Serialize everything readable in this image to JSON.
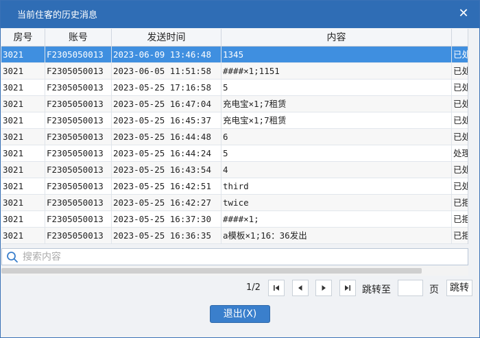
{
  "window": {
    "title": "当前住客的历史消息",
    "close_glyph": "✕"
  },
  "grid": {
    "columns": [
      "房号",
      "账号",
      "发送时间",
      "内容",
      ""
    ],
    "rows": [
      [
        "3021",
        "F2305050013",
        "2023-06-09 13:46:48",
        "1345",
        "已处"
      ],
      [
        "3021",
        "F2305050013",
        "2023-06-05 11:51:58",
        "####×1;1151",
        "已处"
      ],
      [
        "3021",
        "F2305050013",
        "2023-05-25 17:16:58",
        "5",
        "已处"
      ],
      [
        "3021",
        "F2305050013",
        "2023-05-25 16:47:04",
        "充电宝×1;7租赁",
        "已处"
      ],
      [
        "3021",
        "F2305050013",
        "2023-05-25 16:45:37",
        "充电宝×1;7租赁",
        "已处"
      ],
      [
        "3021",
        "F2305050013",
        "2023-05-25 16:44:48",
        "6",
        "已处"
      ],
      [
        "3021",
        "F2305050013",
        "2023-05-25 16:44:24",
        "5",
        "处理"
      ],
      [
        "3021",
        "F2305050013",
        "2023-05-25 16:43:54",
        "4",
        "已处"
      ],
      [
        "3021",
        "F2305050013",
        "2023-05-25 16:42:51",
        "third",
        "已处"
      ],
      [
        "3021",
        "F2305050013",
        "2023-05-25 16:42:27",
        "twice",
        "已拒"
      ],
      [
        "3021",
        "F2305050013",
        "2023-05-25 16:37:30",
        "####×1;",
        "已拒"
      ],
      [
        "3021",
        "F2305050013",
        "2023-05-25 16:36:35",
        "a模板×1;16：36发出",
        "已拒"
      ]
    ],
    "selected_row": 0
  },
  "search": {
    "placeholder": "搜索内容",
    "value": ""
  },
  "pager": {
    "page_info": "1/2",
    "jump_label": "跳转至",
    "jump_value": "",
    "page_label": "页",
    "jump_button": "跳转"
  },
  "footer": {
    "exit_label": "退出(X)"
  },
  "colors": {
    "titlebar": "#2f6db5",
    "selected_row": "#3f8fe0",
    "exit_button": "#3a7fcc"
  }
}
